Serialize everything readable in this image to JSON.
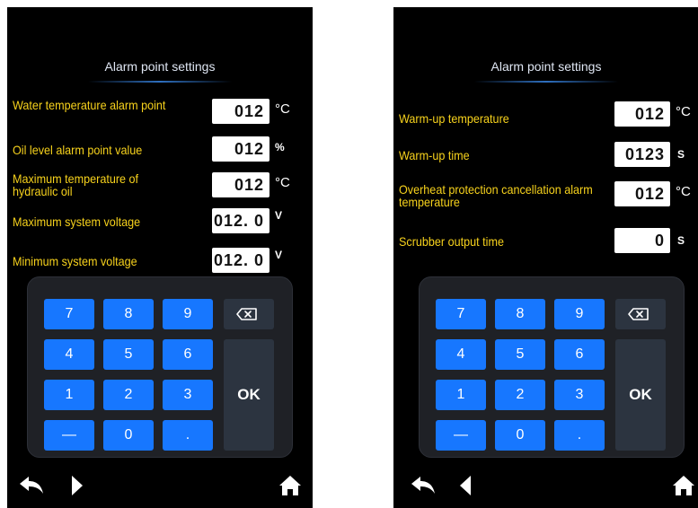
{
  "left_screen": {
    "title": "Alarm point settings",
    "settings": [
      {
        "label": "Water temperature alarm point",
        "value": "012",
        "unit": "°C"
      },
      {
        "label": "Oil level alarm point value",
        "value": "012",
        "unit": "%"
      },
      {
        "label": "Maximum temperature of hydraulic oil",
        "value": "012",
        "unit": "°C"
      },
      {
        "label": "Maximum system voltage",
        "value": "012. 0",
        "unit": "V"
      },
      {
        "label": "Minimum system voltage",
        "value": "012. 0",
        "unit": "V"
      }
    ],
    "keypad": {
      "keys": [
        "7",
        "8",
        "9",
        "4",
        "5",
        "6",
        "1",
        "2",
        "3",
        "—",
        "0",
        "."
      ],
      "ok_label": "OK"
    },
    "nav": {
      "back_icon": "back-arrow-icon",
      "forward_icon": "forward-triangle-icon",
      "home_icon": "home-icon"
    }
  },
  "right_screen": {
    "title": "Alarm point settings",
    "settings": [
      {
        "label": "Warm-up temperature",
        "value": "012",
        "unit": "°C"
      },
      {
        "label": "Warm-up time",
        "value": "0123",
        "unit": "S"
      },
      {
        "label": "Overheat protection cancellation alarm temperature",
        "value": "012",
        "unit": "°C"
      },
      {
        "label": "Scrubber output time",
        "value": "0",
        "unit": "S"
      }
    ],
    "keypad": {
      "keys": [
        "7",
        "8",
        "9",
        "4",
        "5",
        "6",
        "1",
        "2",
        "3",
        "—",
        "0",
        "."
      ],
      "ok_label": "OK"
    },
    "nav": {
      "back_icon": "back-arrow-icon",
      "backward_icon": "back-triangle-icon",
      "home_icon": "home-icon"
    }
  },
  "colors": {
    "label_yellow": "#f7d21c",
    "key_blue": "#1777ff",
    "keypad_bg": "#1f2126",
    "ok_bg": "#2c3440"
  }
}
